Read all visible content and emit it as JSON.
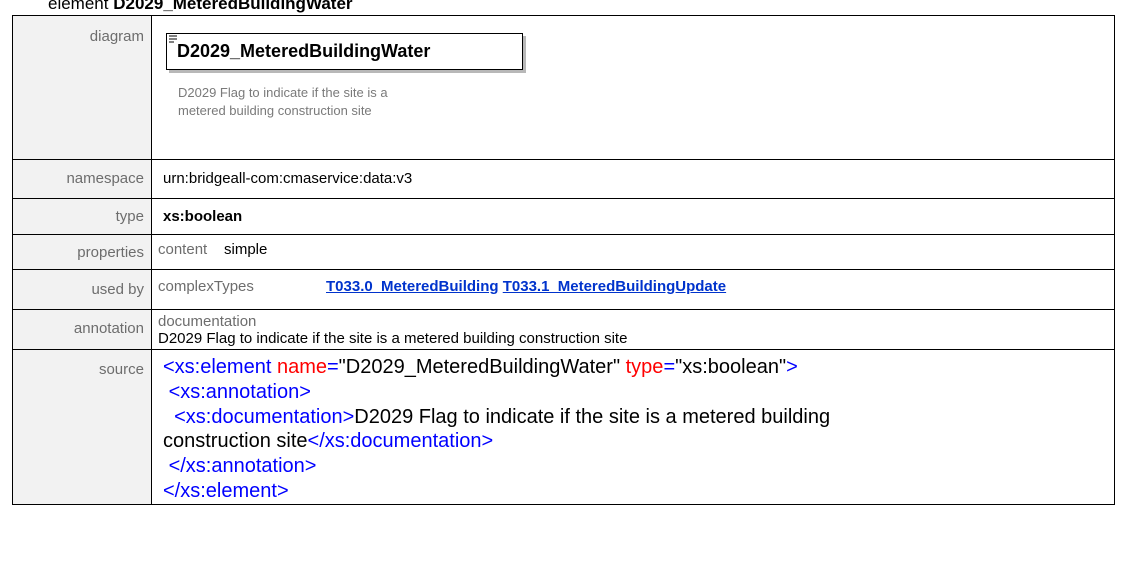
{
  "title": {
    "prefix": "element",
    "name": "D2029_MeteredBuildingWater"
  },
  "rows": {
    "diagram": {
      "label": "diagram",
      "box_name": "D2029_MeteredBuildingWater",
      "note_line1": "D2029 Flag to indicate if the site is a",
      "note_line2": "metered building construction site"
    },
    "namespace": {
      "label": "namespace",
      "value": "urn:bridgeall-com:cmaservice:data:v3"
    },
    "type": {
      "label": "type",
      "value": "xs:boolean"
    },
    "properties": {
      "label": "properties",
      "key": "content",
      "value": "simple"
    },
    "used_by": {
      "label": "used by",
      "key": "complexTypes",
      "links": [
        "T033.0_MeteredBuilding",
        "T033.1_MeteredBuildingUpdate"
      ]
    },
    "annotation": {
      "label": "annotation",
      "key": "documentation",
      "value": "D2029 Flag to indicate if the site is a metered building construction site"
    },
    "source": {
      "label": "source",
      "open_element": "<xs:element",
      "attr_name": "name",
      "attr_name_value": "\"D2029_MeteredBuildingWater\"",
      "attr_type": "type",
      "attr_type_value": "\"xs:boolean\"",
      "close_bracket": ">",
      "annotation_open": "<xs:annotation>",
      "documentation_open": "<xs:documentation>",
      "documentation_text_1": "D2029 Flag to indicate if the site is a metered building",
      "documentation_text_2": "construction site",
      "documentation_close": "</xs:documentation>",
      "annotation_close": "</xs:annotation>",
      "element_close": "</xs:element>",
      "equals": "="
    }
  },
  "colors": {
    "tag": "#0000ff",
    "attribute": "#ff0000",
    "element_text": "#800000",
    "link": "#0033cc",
    "label_text": "#6d6d6d",
    "label_bg": "#f2f2f2"
  }
}
